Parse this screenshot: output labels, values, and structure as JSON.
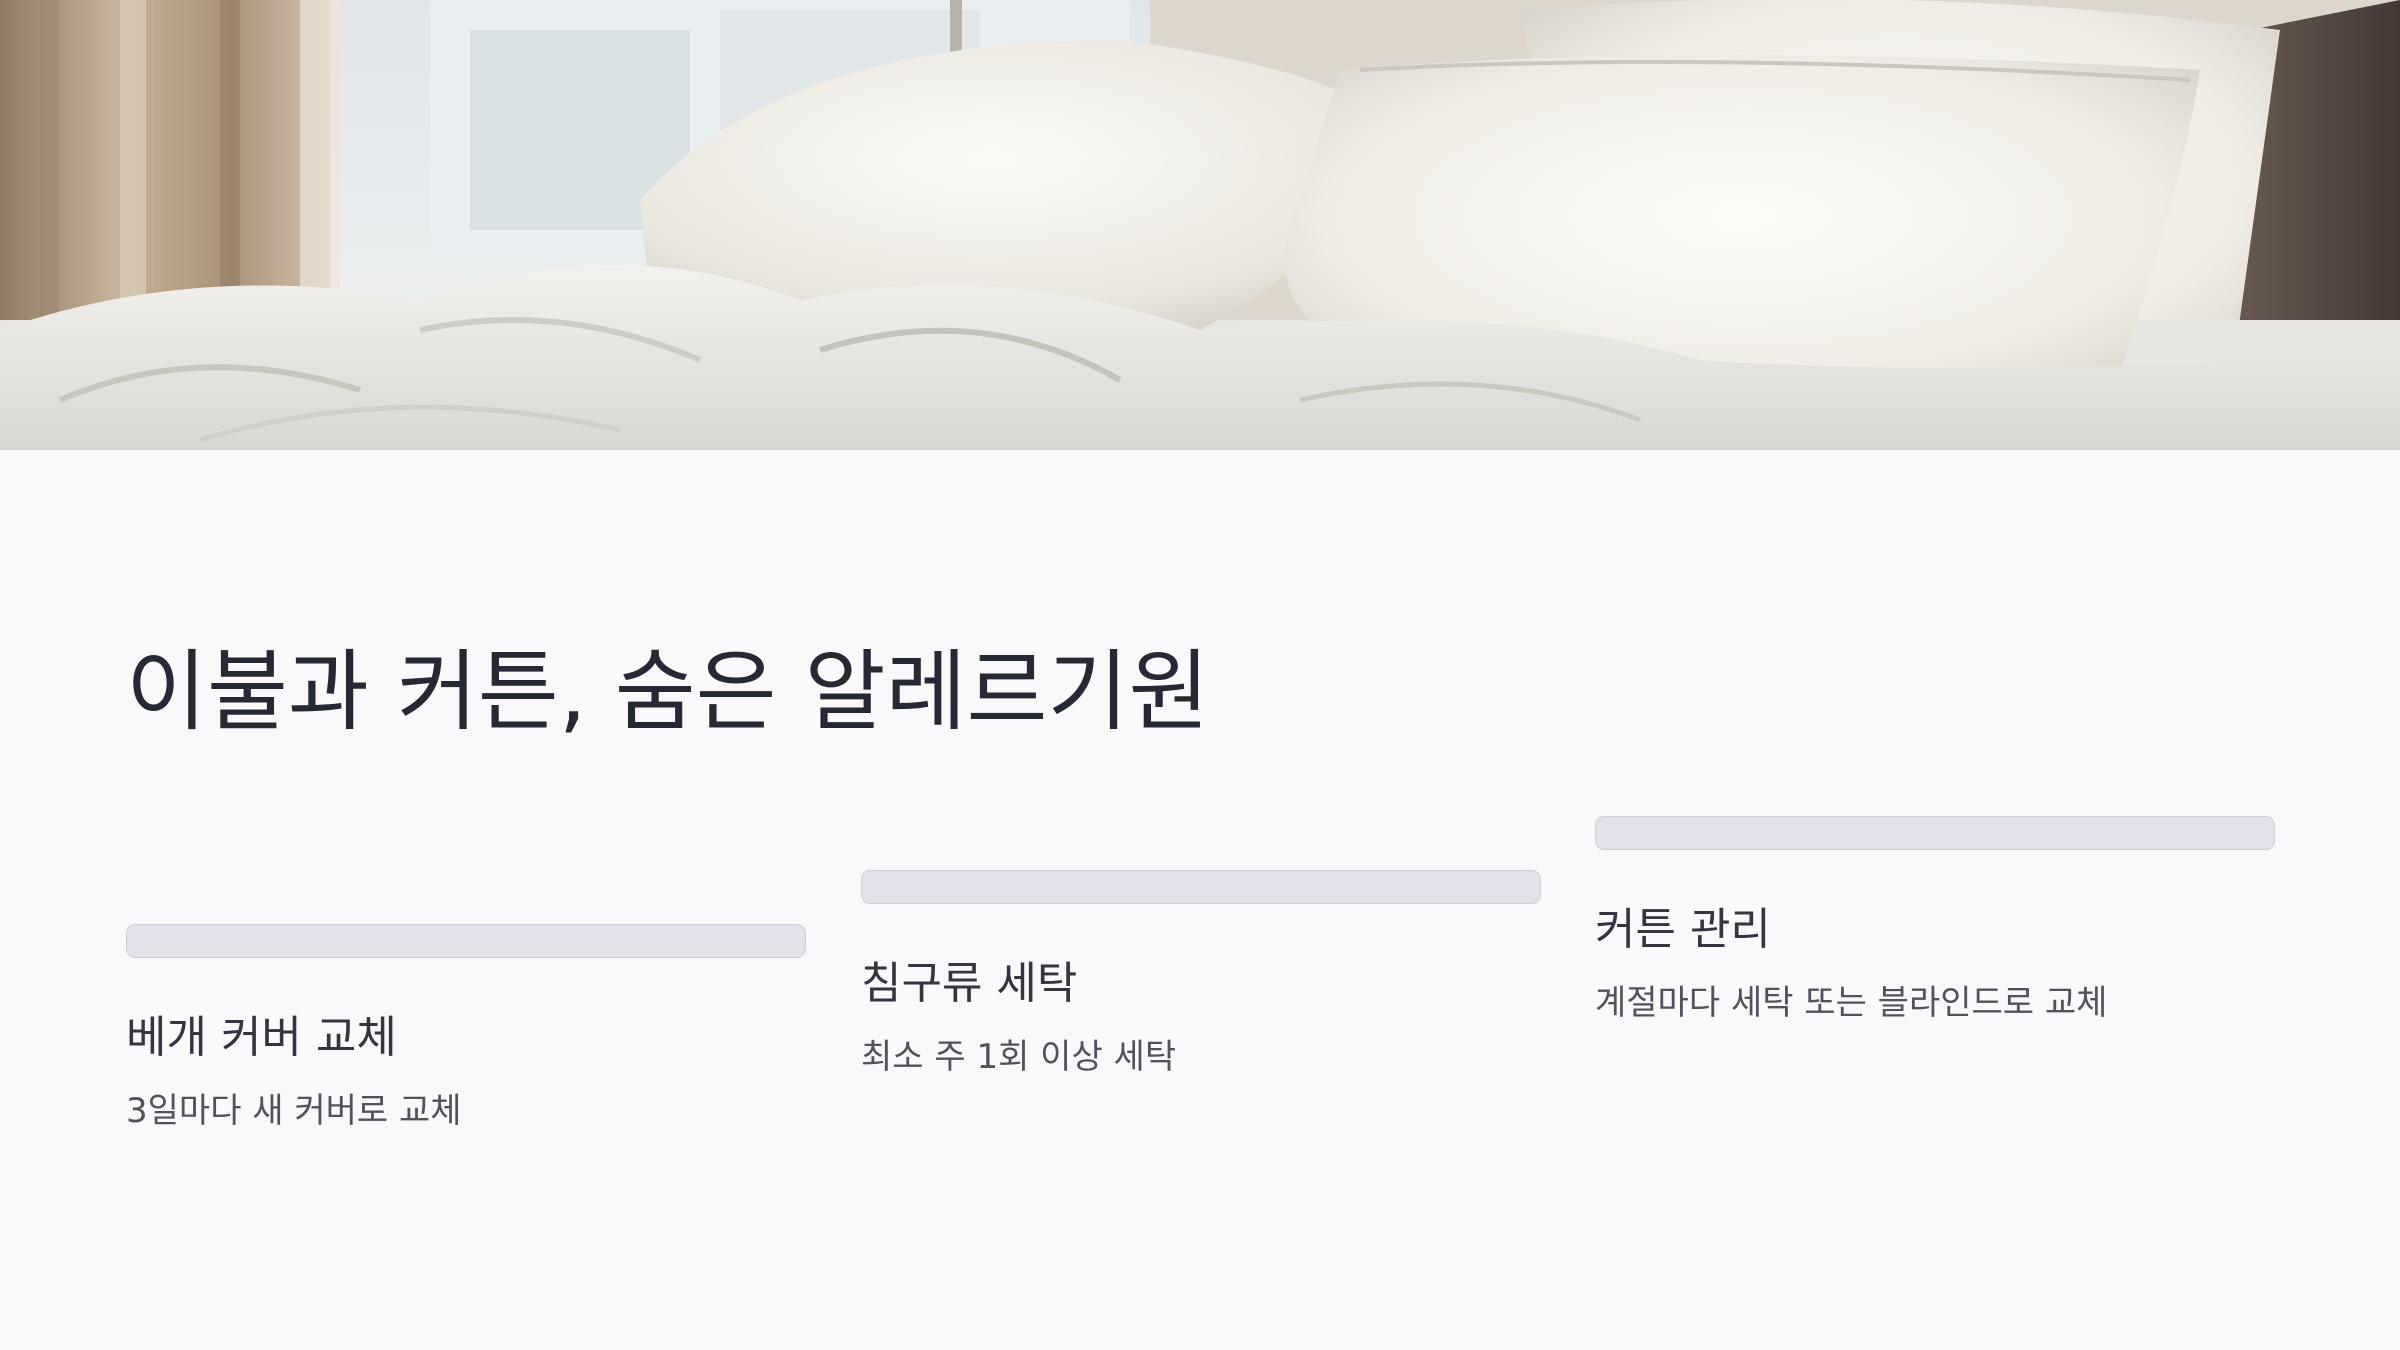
{
  "slide": {
    "title": "이불과 커튼, 숨은 알레르기원",
    "hero_image": {
      "icon": "bedding-photo",
      "colors": {
        "curtain": "#b8a58e",
        "window": "#e6ebee",
        "pillow": "#f1efe9",
        "headboard": "#5b4c45",
        "sheet": "#e9e8e4"
      }
    },
    "cards": [
      {
        "title": "베개 커버 교체",
        "description": "3일마다 새 커버로 교체"
      },
      {
        "title": "침구류 세탁",
        "description": "최소 주 1회 이상 세탁"
      },
      {
        "title": "커튼 관리",
        "description": "계절마다 세탁 또는 블라인드로 교체"
      }
    ]
  }
}
